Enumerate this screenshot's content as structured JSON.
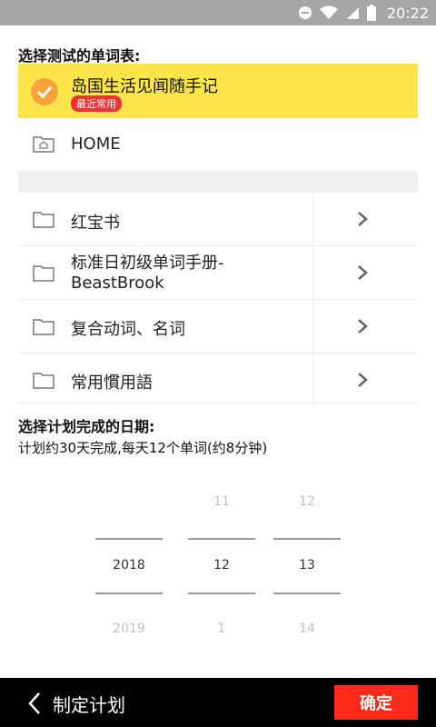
{
  "status_bar": {
    "time": "20:22"
  },
  "wordlist_section": {
    "title": "选择测试的单词表:",
    "selected": {
      "title": "岛国生活见闻随手记",
      "badge": "最近常用"
    },
    "home_label": "HOME",
    "folders": [
      {
        "line1": "红宝书",
        "line2": ""
      },
      {
        "line1": "标准日初级单词手册-",
        "line2": "BeastBrook"
      },
      {
        "line1": "复合动词、名词",
        "line2": ""
      },
      {
        "line1": "常用慣用語",
        "line2": ""
      }
    ]
  },
  "date_section": {
    "title": "选择计划完成的日期:",
    "summary": "计划约30天完成,每天12个单词(约8分钟)",
    "picker": {
      "year": {
        "prev": "",
        "current": "2018",
        "next": "2019"
      },
      "month": {
        "prev": "11",
        "current": "12",
        "next": "1"
      },
      "day": {
        "prev": "12",
        "current": "13",
        "next": "14"
      }
    }
  },
  "bottom_bar": {
    "title": "制定计划",
    "confirm_label": "确定"
  },
  "colors": {
    "selected_bg": "#fbe54a",
    "check": "#f7a43a",
    "badge": "#e33333",
    "confirm": "#ff2a1a"
  }
}
